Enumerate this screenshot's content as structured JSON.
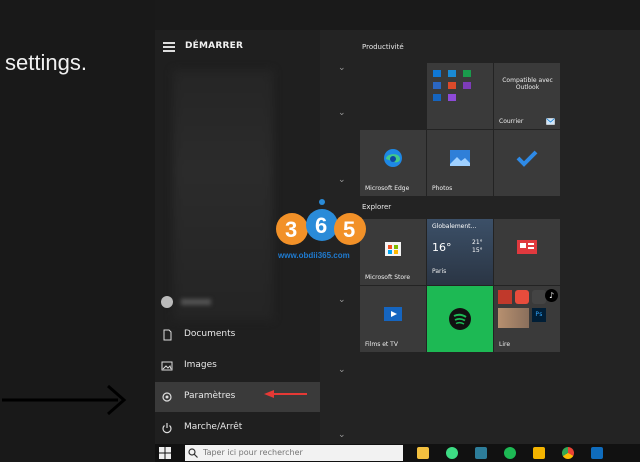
{
  "slide": {
    "text": "settings."
  },
  "start": {
    "title": "DÉMARRER",
    "menu": [
      {
        "label": "Documents",
        "icon": "document-icon"
      },
      {
        "label": "Images",
        "icon": "image-icon"
      },
      {
        "label": "Paramètres",
        "icon": "gear-icon"
      },
      {
        "label": "Marche/Arrêt",
        "icon": "power-icon"
      }
    ]
  },
  "groups": {
    "productivity": "Productivité",
    "explore": "Explorer"
  },
  "tiles": {
    "outlook": "Compatible avec Outlook",
    "mail": "Courrier",
    "edge": "Microsoft Edge",
    "photos": "Photos",
    "weather_title": "Globalement…",
    "weather_temp": "16°",
    "weather_hi": "21°",
    "weather_lo": "15°",
    "weather_city": "Paris",
    "store": "Microsoft Store",
    "films": "Films et TV",
    "play": "Lire"
  },
  "taskbar": {
    "search_placeholder": "Taper ici pour rechercher"
  },
  "watermark": {
    "url": "www.obdii365.com"
  },
  "colors": {
    "accent_blue": "#0078d7",
    "spotify": "#1db954",
    "arrow_red": "#e53935"
  }
}
